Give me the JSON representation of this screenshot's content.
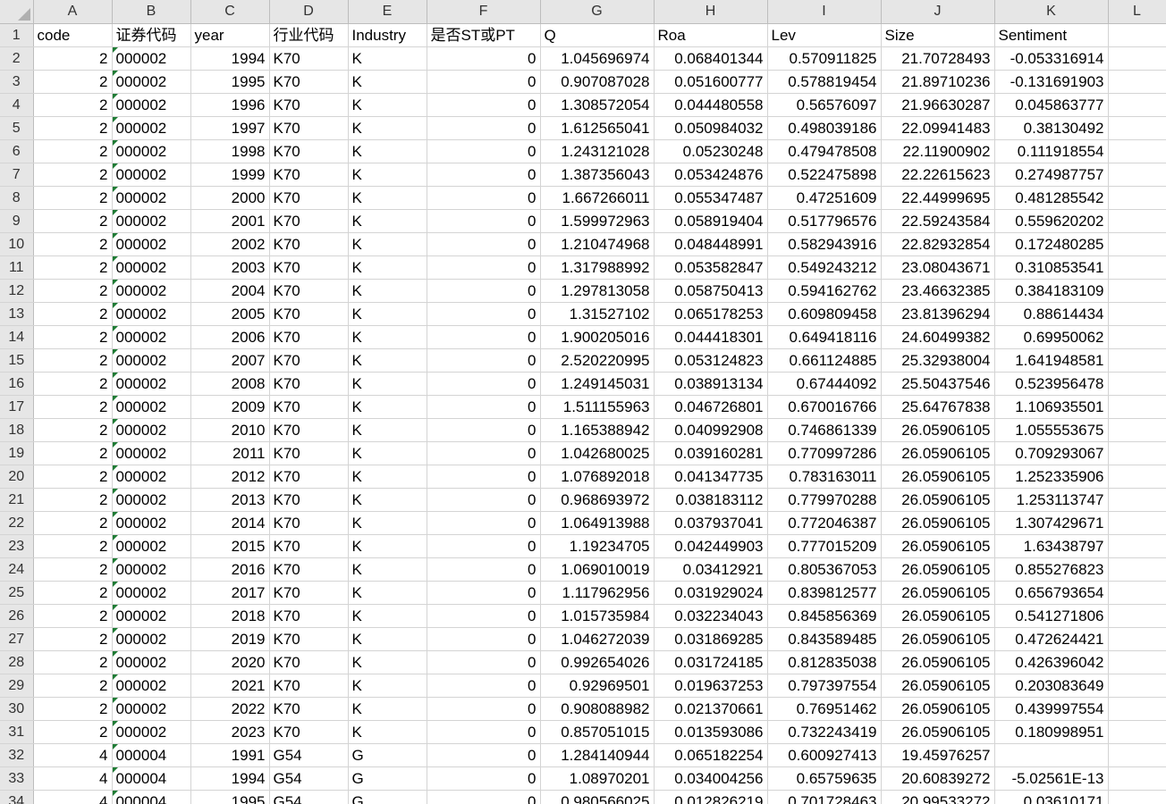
{
  "columns": [
    "",
    "A",
    "B",
    "C",
    "D",
    "E",
    "F",
    "G",
    "H",
    "I",
    "J",
    "K",
    "L"
  ],
  "rows": [
    {
      "n": "1",
      "cells": [
        "code",
        "证券代码",
        "year",
        "行业代码",
        "Industry",
        "是否ST或PT",
        "Q",
        "Roa",
        "Lev",
        "Size",
        "Sentiment",
        ""
      ]
    },
    {
      "n": "2",
      "cells": [
        "2",
        "000002",
        "1994",
        "K70",
        "K",
        "0",
        "1.045696974",
        "0.068401344",
        "0.570911825",
        "21.70728493",
        "-0.053316914",
        ""
      ]
    },
    {
      "n": "3",
      "cells": [
        "2",
        "000002",
        "1995",
        "K70",
        "K",
        "0",
        "0.907087028",
        "0.051600777",
        "0.578819454",
        "21.89710236",
        "-0.131691903",
        ""
      ]
    },
    {
      "n": "4",
      "cells": [
        "2",
        "000002",
        "1996",
        "K70",
        "K",
        "0",
        "1.308572054",
        "0.044480558",
        "0.56576097",
        "21.96630287",
        "0.045863777",
        ""
      ]
    },
    {
      "n": "5",
      "cells": [
        "2",
        "000002",
        "1997",
        "K70",
        "K",
        "0",
        "1.612565041",
        "0.050984032",
        "0.498039186",
        "22.09941483",
        "0.38130492",
        ""
      ]
    },
    {
      "n": "6",
      "cells": [
        "2",
        "000002",
        "1998",
        "K70",
        "K",
        "0",
        "1.243121028",
        "0.05230248",
        "0.479478508",
        "22.11900902",
        "0.111918554",
        ""
      ]
    },
    {
      "n": "7",
      "cells": [
        "2",
        "000002",
        "1999",
        "K70",
        "K",
        "0",
        "1.387356043",
        "0.053424876",
        "0.522475898",
        "22.22615623",
        "0.274987757",
        ""
      ]
    },
    {
      "n": "8",
      "cells": [
        "2",
        "000002",
        "2000",
        "K70",
        "K",
        "0",
        "1.667266011",
        "0.055347487",
        "0.47251609",
        "22.44999695",
        "0.481285542",
        ""
      ]
    },
    {
      "n": "9",
      "cells": [
        "2",
        "000002",
        "2001",
        "K70",
        "K",
        "0",
        "1.599972963",
        "0.058919404",
        "0.517796576",
        "22.59243584",
        "0.559620202",
        ""
      ]
    },
    {
      "n": "10",
      "cells": [
        "2",
        "000002",
        "2002",
        "K70",
        "K",
        "0",
        "1.210474968",
        "0.048448991",
        "0.582943916",
        "22.82932854",
        "0.172480285",
        ""
      ]
    },
    {
      "n": "11",
      "cells": [
        "2",
        "000002",
        "2003",
        "K70",
        "K",
        "0",
        "1.317988992",
        "0.053582847",
        "0.549243212",
        "23.08043671",
        "0.310853541",
        ""
      ]
    },
    {
      "n": "12",
      "cells": [
        "2",
        "000002",
        "2004",
        "K70",
        "K",
        "0",
        "1.297813058",
        "0.058750413",
        "0.594162762",
        "23.46632385",
        "0.384183109",
        ""
      ]
    },
    {
      "n": "13",
      "cells": [
        "2",
        "000002",
        "2005",
        "K70",
        "K",
        "0",
        "1.31527102",
        "0.065178253",
        "0.609809458",
        "23.81396294",
        "0.88614434",
        ""
      ]
    },
    {
      "n": "14",
      "cells": [
        "2",
        "000002",
        "2006",
        "K70",
        "K",
        "0",
        "1.900205016",
        "0.044418301",
        "0.649418116",
        "24.60499382",
        "0.69950062",
        ""
      ]
    },
    {
      "n": "15",
      "cells": [
        "2",
        "000002",
        "2007",
        "K70",
        "K",
        "0",
        "2.520220995",
        "0.053124823",
        "0.661124885",
        "25.32938004",
        "1.641948581",
        ""
      ]
    },
    {
      "n": "16",
      "cells": [
        "2",
        "000002",
        "2008",
        "K70",
        "K",
        "0",
        "1.249145031",
        "0.038913134",
        "0.67444092",
        "25.50437546",
        "0.523956478",
        ""
      ]
    },
    {
      "n": "17",
      "cells": [
        "2",
        "000002",
        "2009",
        "K70",
        "K",
        "0",
        "1.511155963",
        "0.046726801",
        "0.670016766",
        "25.64767838",
        "1.106935501",
        ""
      ]
    },
    {
      "n": "18",
      "cells": [
        "2",
        "000002",
        "2010",
        "K70",
        "K",
        "0",
        "1.165388942",
        "0.040992908",
        "0.746861339",
        "26.05906105",
        "1.055553675",
        ""
      ]
    },
    {
      "n": "19",
      "cells": [
        "2",
        "000002",
        "2011",
        "K70",
        "K",
        "0",
        "1.042680025",
        "0.039160281",
        "0.770997286",
        "26.05906105",
        "0.709293067",
        ""
      ]
    },
    {
      "n": "20",
      "cells": [
        "2",
        "000002",
        "2012",
        "K70",
        "K",
        "0",
        "1.076892018",
        "0.041347735",
        "0.783163011",
        "26.05906105",
        "1.252335906",
        ""
      ]
    },
    {
      "n": "21",
      "cells": [
        "2",
        "000002",
        "2013",
        "K70",
        "K",
        "0",
        "0.968693972",
        "0.038183112",
        "0.779970288",
        "26.05906105",
        "1.253113747",
        ""
      ]
    },
    {
      "n": "22",
      "cells": [
        "2",
        "000002",
        "2014",
        "K70",
        "K",
        "0",
        "1.064913988",
        "0.037937041",
        "0.772046387",
        "26.05906105",
        "1.307429671",
        ""
      ]
    },
    {
      "n": "23",
      "cells": [
        "2",
        "000002",
        "2015",
        "K70",
        "K",
        "0",
        "1.19234705",
        "0.042449903",
        "0.777015209",
        "26.05906105",
        "1.63438797",
        ""
      ]
    },
    {
      "n": "24",
      "cells": [
        "2",
        "000002",
        "2016",
        "K70",
        "K",
        "0",
        "1.069010019",
        "0.03412921",
        "0.805367053",
        "26.05906105",
        "0.855276823",
        ""
      ]
    },
    {
      "n": "25",
      "cells": [
        "2",
        "000002",
        "2017",
        "K70",
        "K",
        "0",
        "1.117962956",
        "0.031929024",
        "0.839812577",
        "26.05906105",
        "0.656793654",
        ""
      ]
    },
    {
      "n": "26",
      "cells": [
        "2",
        "000002",
        "2018",
        "K70",
        "K",
        "0",
        "1.015735984",
        "0.032234043",
        "0.845856369",
        "26.05906105",
        "0.541271806",
        ""
      ]
    },
    {
      "n": "27",
      "cells": [
        "2",
        "000002",
        "2019",
        "K70",
        "K",
        "0",
        "1.046272039",
        "0.031869285",
        "0.843589485",
        "26.05906105",
        "0.472624421",
        ""
      ]
    },
    {
      "n": "28",
      "cells": [
        "2",
        "000002",
        "2020",
        "K70",
        "K",
        "0",
        "0.992654026",
        "0.031724185",
        "0.812835038",
        "26.05906105",
        "0.426396042",
        ""
      ]
    },
    {
      "n": "29",
      "cells": [
        "2",
        "000002",
        "2021",
        "K70",
        "K",
        "0",
        "0.92969501",
        "0.019637253",
        "0.797397554",
        "26.05906105",
        "0.203083649",
        ""
      ]
    },
    {
      "n": "30",
      "cells": [
        "2",
        "000002",
        "2022",
        "K70",
        "K",
        "0",
        "0.908088982",
        "0.021370661",
        "0.76951462",
        "26.05906105",
        "0.439997554",
        ""
      ]
    },
    {
      "n": "31",
      "cells": [
        "2",
        "000002",
        "2023",
        "K70",
        "K",
        "0",
        "0.857051015",
        "0.013593086",
        "0.732243419",
        "26.05906105",
        "0.180998951",
        ""
      ]
    },
    {
      "n": "32",
      "cells": [
        "4",
        "000004",
        "1991",
        "G54",
        "G",
        "0",
        "1.284140944",
        "0.065182254",
        "0.600927413",
        "19.45976257",
        "",
        ""
      ]
    },
    {
      "n": "33",
      "cells": [
        "4",
        "000004",
        "1994",
        "G54",
        "G",
        "0",
        "1.08970201",
        "0.034004256",
        "0.65759635",
        "20.60839272",
        "-5.02561E-13",
        ""
      ]
    },
    {
      "n": "34",
      "cells": [
        "4",
        "000004",
        "1995",
        "G54",
        "G",
        "0",
        "0.980566025",
        "0.012826219",
        "0.701728463",
        "20.99533272",
        "0.03610171",
        ""
      ]
    }
  ]
}
